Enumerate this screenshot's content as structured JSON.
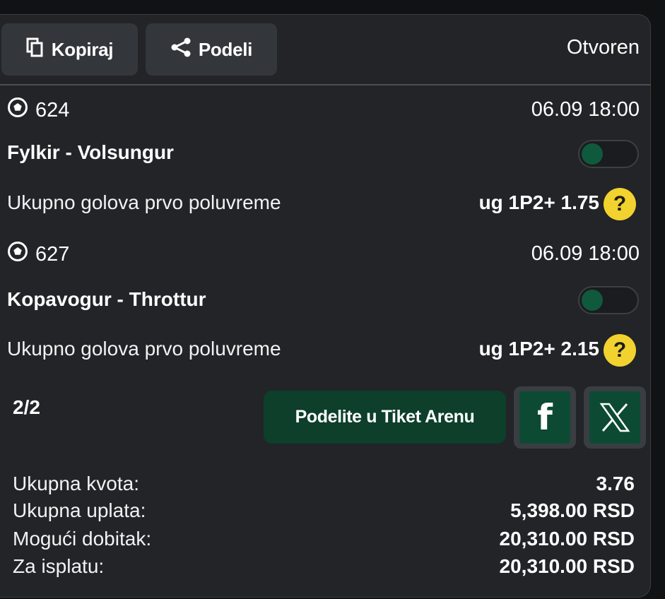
{
  "toolbar": {
    "copy_label": "Kopiraj",
    "share_label": "Podeli",
    "status": "Otvoren"
  },
  "matches": [
    {
      "id": "624",
      "datetime": "06.09 18:00",
      "teams": "Fylkir - Volsungur",
      "market": "Ukupno golova prvo poluvreme",
      "pick": "ug 1P2+ 1.75",
      "help": "?"
    },
    {
      "id": "627",
      "datetime": "06.09 18:00",
      "teams": "Kopavogur - Throttur",
      "market": "Ukupno golova prvo poluvreme",
      "pick": "ug 1P2+ 2.15",
      "help": "?"
    }
  ],
  "footer": {
    "count": "2/2",
    "arena_label": "Podelite u Tiket Arenu",
    "facebook_glyph": "f"
  },
  "summary": [
    {
      "label": "Ukupna kvota:",
      "value": "3.76"
    },
    {
      "label": "Ukupna uplata:",
      "value": "5,398.00 RSD"
    },
    {
      "label": "Mogući dobitak:",
      "value": "20,310.00 RSD"
    },
    {
      "label": "Za isplatu:",
      "value": "20,310.00 RSD"
    }
  ],
  "colors": {
    "card_bg": "#222427",
    "button_bg": "#33363b",
    "accent_green": "#0d3f2b",
    "help_yellow": "#f2d22e"
  },
  "icons": [
    "copy-icon",
    "share-icon",
    "soccer-ball-icon",
    "facebook-icon",
    "x-icon",
    "help-icon"
  ]
}
